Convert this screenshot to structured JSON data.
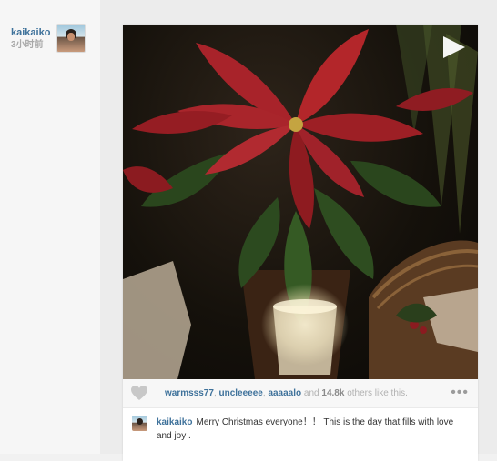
{
  "post": {
    "author": {
      "username": "kaikaiko",
      "time": "3小时前"
    },
    "media": {
      "play_icon": "play-icon"
    },
    "likes": {
      "heart_icon": "heart-icon",
      "users": [
        "warmsss77",
        "uncleeeee",
        "aaaaalo"
      ],
      "separator": ", ",
      "and_text": "and",
      "count": "14.8k",
      "suffix": "others like this.",
      "more_label": "•••"
    },
    "comments": [
      {
        "username": "kaikaiko",
        "text": "Merry Christmas everyone！！ This is the day that fills with love and joy ."
      }
    ]
  },
  "colors": {
    "link": "#3f729b",
    "muted": "#a9a9a9",
    "card": "#ffffff",
    "background": "#ececec",
    "poinsettia_red": "#b3262a",
    "leaf_green": "#2c4a1f"
  }
}
